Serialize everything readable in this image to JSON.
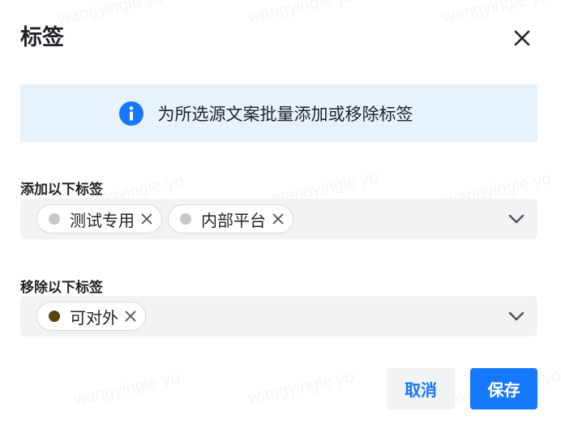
{
  "dialog": {
    "title": "标签",
    "close_icon": "close-icon"
  },
  "info": {
    "icon": "info-icon",
    "text": "为所选源文案批量添加或移除标签"
  },
  "add_section": {
    "label": "添加以下标签",
    "tags": [
      {
        "text": "测试专用",
        "dot_color": "#c5c7cc"
      },
      {
        "text": "内部平台",
        "dot_color": "#c5c7cc"
      }
    ]
  },
  "remove_section": {
    "label": "移除以下标签",
    "tags": [
      {
        "text": "可对外",
        "dot_color": "#5c4512"
      }
    ]
  },
  "footer": {
    "cancel_label": "取消",
    "save_label": "保存"
  },
  "watermark": "wangyingle yo",
  "colors": {
    "primary": "#1677ff",
    "info_bg": "#e8f2fd",
    "select_bg": "#f2f3f5"
  }
}
